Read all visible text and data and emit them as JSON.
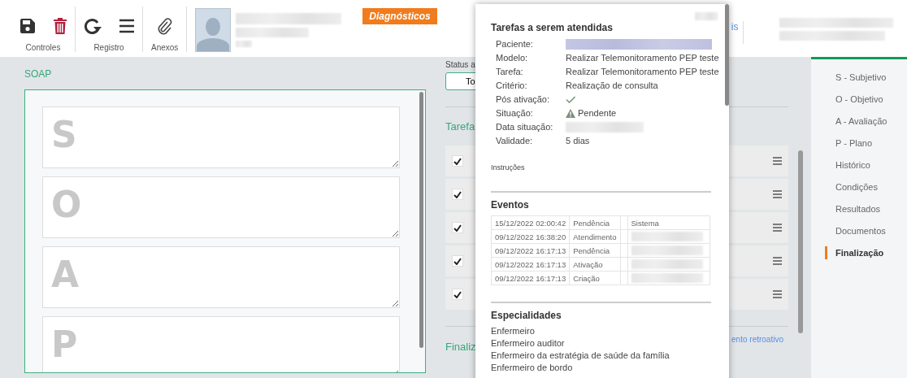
{
  "toolbar": {
    "groups": [
      {
        "label": "Controles",
        "tools": [
          {
            "kind": "save"
          },
          {
            "kind": "trash"
          }
        ]
      },
      {
        "label": "Registro",
        "tools": [
          {
            "kind": "refresh"
          },
          {
            "kind": "menu"
          }
        ]
      },
      {
        "label": "Anexos",
        "tools": [
          {
            "kind": "clip"
          }
        ]
      }
    ],
    "badge": "Diagnósticos",
    "link_fragment": "is"
  },
  "soap": {
    "title": "SOAP",
    "fields": [
      {
        "placeholder": "S"
      },
      {
        "placeholder": "O"
      },
      {
        "placeholder": "A"
      },
      {
        "placeholder": "P"
      }
    ]
  },
  "middle": {
    "status_label": "Status a",
    "status_button": "To",
    "tasks_title": "Tarefa",
    "tasks": [
      {
        "checked": true
      },
      {
        "checked": true
      },
      {
        "checked": true
      },
      {
        "checked": true
      },
      {
        "checked": true
      }
    ],
    "final_title": "Finaliz",
    "retro_link": "ento retroativo"
  },
  "popup": {
    "title": "Tarefas a serem atendidas",
    "fields": [
      {
        "label": "Paciente:",
        "kind": "blurred"
      },
      {
        "label": "Modelo:",
        "kind": "text",
        "value": "Realizar Telemonitoramento PEP teste"
      },
      {
        "label": "Tarefa:",
        "kind": "text",
        "value": "Realizar Telemonitoramento PEP teste"
      },
      {
        "label": "Critério:",
        "kind": "text",
        "value": "Realização de consulta"
      },
      {
        "label": "Pós ativação:",
        "kind": "check"
      },
      {
        "label": "Situação:",
        "kind": "warning",
        "value": "Pendente"
      },
      {
        "label": "Data situação:",
        "kind": "blurred"
      },
      {
        "label": "Validade:",
        "kind": "text",
        "value": "5 dias"
      }
    ],
    "instructions_label": "Instruções",
    "events_title": "Eventos",
    "events": [
      {
        "date": "15/12/2022 02:00:42",
        "type": "Pendência",
        "user": "Sistema"
      },
      {
        "date": "09/12/2022 16:38:20",
        "type": "Atendimento"
      },
      {
        "date": "09/12/2022 16:17:13",
        "type": "Pendência"
      },
      {
        "date": "09/12/2022 16:17:13",
        "type": "Ativação"
      },
      {
        "date": "09/12/2022 16:17:13",
        "type": "Criação"
      }
    ],
    "specialties_title": "Especialidades",
    "specialties": [
      "Enfermeiro",
      "Enfermeiro auditor",
      "Enfermeiro da estratégia de saúde da família",
      "Enfermeiro de bordo"
    ]
  },
  "sidebar": {
    "items": [
      {
        "label": "S - Subjetivo",
        "selected": false
      },
      {
        "label": "O - Objetivo",
        "selected": false
      },
      {
        "label": "A - Avaliação",
        "selected": false
      },
      {
        "label": "P - Plano",
        "selected": false
      },
      {
        "label": "Histórico",
        "selected": false
      },
      {
        "label": "Condições",
        "selected": false
      },
      {
        "label": "Resultados",
        "selected": false
      },
      {
        "label": "Documentos",
        "selected": false
      },
      {
        "label": "Finalização",
        "selected": true
      }
    ]
  }
}
